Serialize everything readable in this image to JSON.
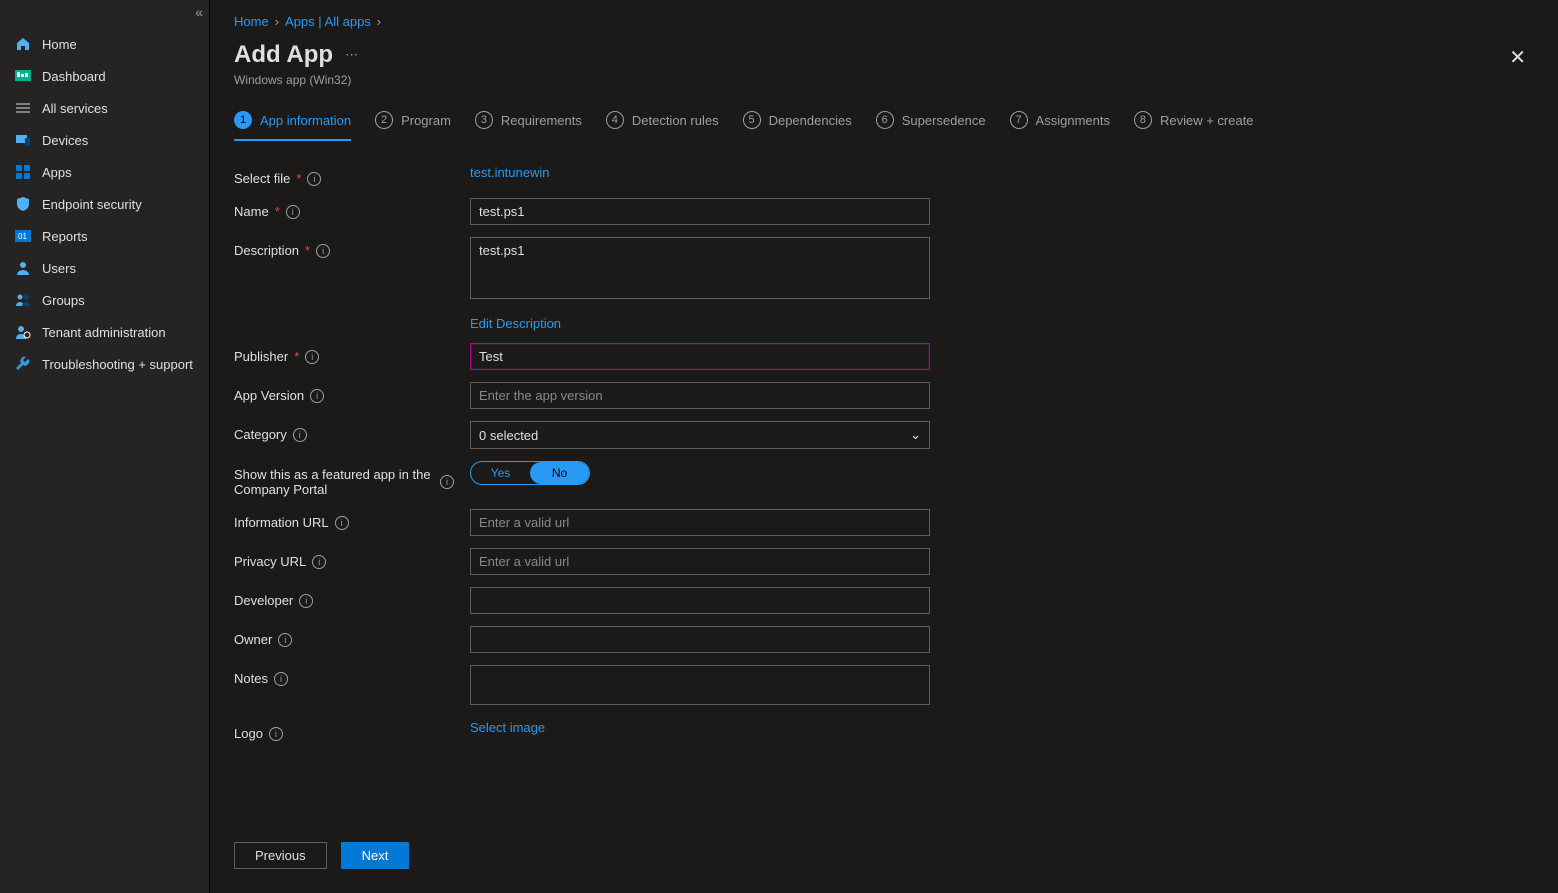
{
  "sidebar": {
    "items": [
      {
        "label": "Home",
        "color": "#50b0f4"
      },
      {
        "label": "Dashboard",
        "color": "#00b294"
      },
      {
        "label": "All services",
        "color": "#a19f9d"
      },
      {
        "label": "Devices",
        "color": "#50b0f4"
      },
      {
        "label": "Apps",
        "color": "#0078d4"
      },
      {
        "label": "Endpoint security",
        "color": "#50b0f4"
      },
      {
        "label": "Reports",
        "color": "#0078d4"
      },
      {
        "label": "Users",
        "color": "#50b0f4"
      },
      {
        "label": "Groups",
        "color": "#50b0f4"
      },
      {
        "label": "Tenant administration",
        "color": "#50b0f4"
      },
      {
        "label": "Troubleshooting + support",
        "color": "#3a96dd"
      }
    ]
  },
  "breadcrumb": {
    "home": "Home",
    "apps": "Apps | All apps"
  },
  "header": {
    "title": "Add App",
    "sub": "Windows app (Win32)",
    "menu": "⋯"
  },
  "tabs": [
    {
      "n": "1",
      "label": "App information",
      "active": true
    },
    {
      "n": "2",
      "label": "Program"
    },
    {
      "n": "3",
      "label": "Requirements"
    },
    {
      "n": "4",
      "label": "Detection rules"
    },
    {
      "n": "5",
      "label": "Dependencies"
    },
    {
      "n": "6",
      "label": "Supersedence"
    },
    {
      "n": "7",
      "label": "Assignments"
    },
    {
      "n": "8",
      "label": "Review + create"
    }
  ],
  "form": {
    "select_file": {
      "label": "Select file",
      "link": "test.intunewin"
    },
    "name": {
      "label": "Name",
      "value": "test.ps1"
    },
    "description": {
      "label": "Description",
      "value": "test.ps1",
      "edit": "Edit Description"
    },
    "publisher": {
      "label": "Publisher",
      "value": "Test"
    },
    "app_version": {
      "label": "App Version",
      "placeholder": "Enter the app version",
      "value": ""
    },
    "category": {
      "label": "Category",
      "value": "0 selected"
    },
    "featured": {
      "label": "Show this as a featured app in the Company Portal",
      "yes": "Yes",
      "no": "No"
    },
    "info_url": {
      "label": "Information URL",
      "placeholder": "Enter a valid url",
      "value": ""
    },
    "privacy_url": {
      "label": "Privacy URL",
      "placeholder": "Enter a valid url",
      "value": ""
    },
    "developer": {
      "label": "Developer",
      "value": ""
    },
    "owner": {
      "label": "Owner",
      "value": ""
    },
    "notes": {
      "label": "Notes",
      "value": ""
    },
    "logo": {
      "label": "Logo",
      "link": "Select image"
    }
  },
  "footer": {
    "previous": "Previous",
    "next": "Next"
  }
}
